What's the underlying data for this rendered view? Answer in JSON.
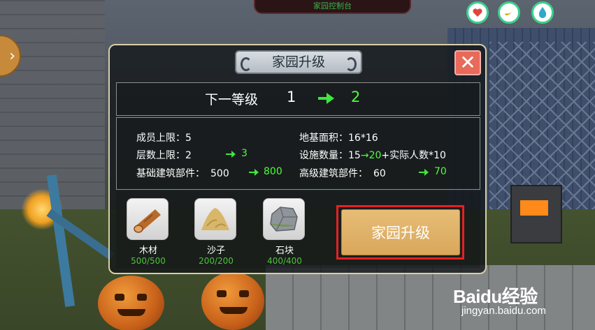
{
  "hud": {
    "top_title": "家园控制台",
    "icons": [
      "heart-icon",
      "banana-icon",
      "water-drop-icon"
    ],
    "side_button_glyph": "›"
  },
  "dialog": {
    "title": "家园升级",
    "close_glyph": "✕",
    "level": {
      "label": "下一等级",
      "current": "1",
      "next": "2"
    },
    "stats": {
      "members": {
        "label": "成员上限：",
        "value": "5"
      },
      "floors": {
        "label": "层数上限：",
        "value": "2",
        "next": "3"
      },
      "basic_parts": {
        "label": "基础建筑部件：",
        "value": "500",
        "next": "800"
      },
      "area": {
        "label": "地基面积：",
        "value": "16*16"
      },
      "facilities": {
        "label": "设施数量：",
        "value": "15",
        "next": "20",
        "suffix": "+实际人数*10"
      },
      "advanced_parts": {
        "label": "高级建筑部件：",
        "value": "60",
        "next": "70"
      }
    },
    "items": [
      {
        "name": "木材",
        "count": "500/500",
        "icon": "wood-log-icon"
      },
      {
        "name": "沙子",
        "count": "200/200",
        "icon": "sand-pile-icon"
      },
      {
        "name": "石块",
        "count": "400/400",
        "icon": "stone-block-icon"
      }
    ],
    "upgrade_button": "家园升级",
    "colors": {
      "accent_green": "#4dff3a",
      "button": "#e0b268",
      "close": "#e86a5a",
      "highlight": "#e32222"
    }
  },
  "watermark": {
    "logo": "Baidu经验",
    "url": "jingyan.baidu.com"
  }
}
